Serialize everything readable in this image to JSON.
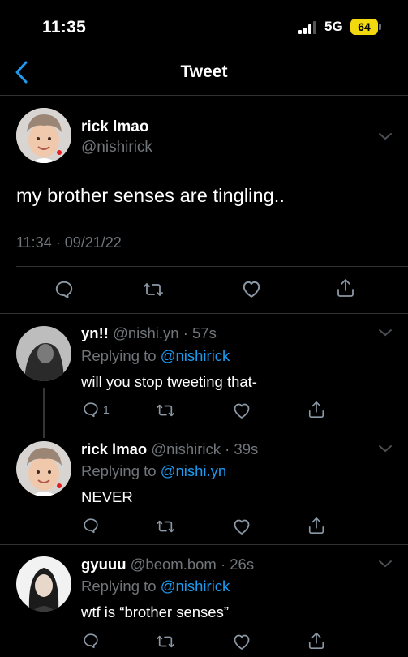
{
  "status_bar": {
    "time": "11:35",
    "network": "5G",
    "battery": "64"
  },
  "nav": {
    "title": "Tweet"
  },
  "main_tweet": {
    "name": "rick lmao",
    "handle": "@nishirick",
    "text": "my brother senses are tingling..",
    "timestamp": "11:34 · 09/21/22"
  },
  "replies": [
    {
      "name": "yn!!",
      "handle": "@nishi.yn · 57s",
      "replying_prefix": "Replying to",
      "replying_to": "@nishirick",
      "text": "will you stop tweeting that-",
      "reply_count": "1"
    },
    {
      "name": "rick lmao",
      "handle": "@nishirick · 39s",
      "replying_prefix": "Replying to",
      "replying_to": "@nishi.yn",
      "text": "NEVER"
    },
    {
      "name": "gyuuu",
      "handle": "@beom.bom · 26s",
      "replying_prefix": "Replying to",
      "replying_to": "@nishirick",
      "text": "wtf is “brother senses”"
    }
  ],
  "icons": [
    "signal-icon",
    "battery-icon",
    "back-chevron-icon",
    "chevron-down-icon",
    "reply-icon",
    "retweet-icon",
    "like-icon",
    "share-icon"
  ],
  "colors": {
    "background": "#000000",
    "accent": "#1d9bf0",
    "muted": "#71767b",
    "battery": "#f2d80e"
  }
}
